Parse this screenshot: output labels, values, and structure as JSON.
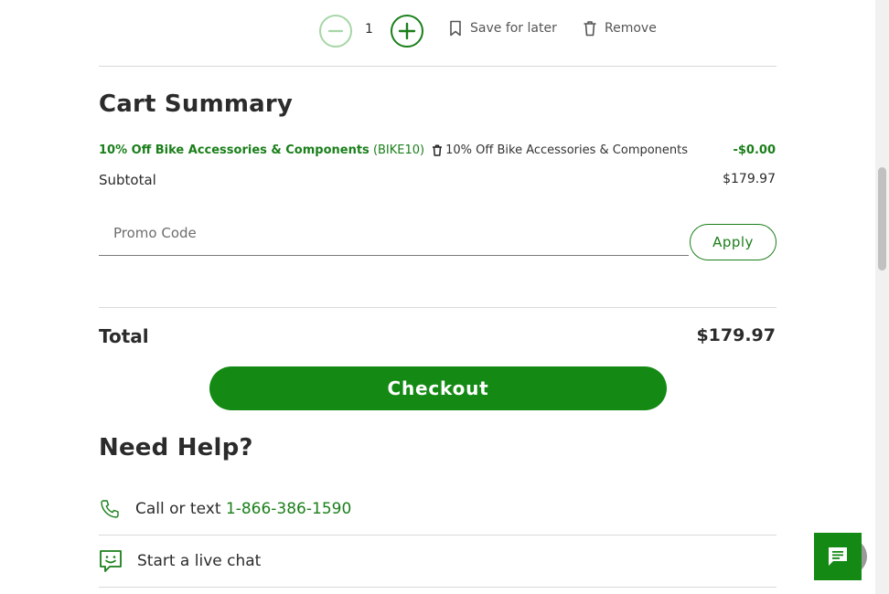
{
  "item_controls": {
    "quantity": "1",
    "save_for_later": "Save for later",
    "remove": "Remove"
  },
  "cart_summary": {
    "title": "Cart Summary",
    "promo_name": "10% Off Bike Accessories & Components",
    "promo_code": "(BIKE10)",
    "promo_description": "10% Off Bike Accessories & Components",
    "discount": "-$0.00",
    "subtotal_label": "Subtotal",
    "subtotal_value": "$179.97",
    "promo_input_placeholder": "Promo Code",
    "apply_label": "Apply",
    "total_label": "Total",
    "total_value": "$179.97",
    "checkout_label": "Checkout"
  },
  "help": {
    "title": "Need Help?",
    "call_text": "Call or text",
    "phone": "1-866-386-1590",
    "chat_text": "Start a live chat"
  },
  "colors": {
    "accent": "#148a14",
    "brand_green": "#1a7f1a"
  },
  "icons": [
    "minus-icon",
    "plus-icon",
    "bookmark-icon",
    "trash-icon",
    "phone-icon",
    "chat-smile-icon",
    "chat-bubble-icon"
  ]
}
